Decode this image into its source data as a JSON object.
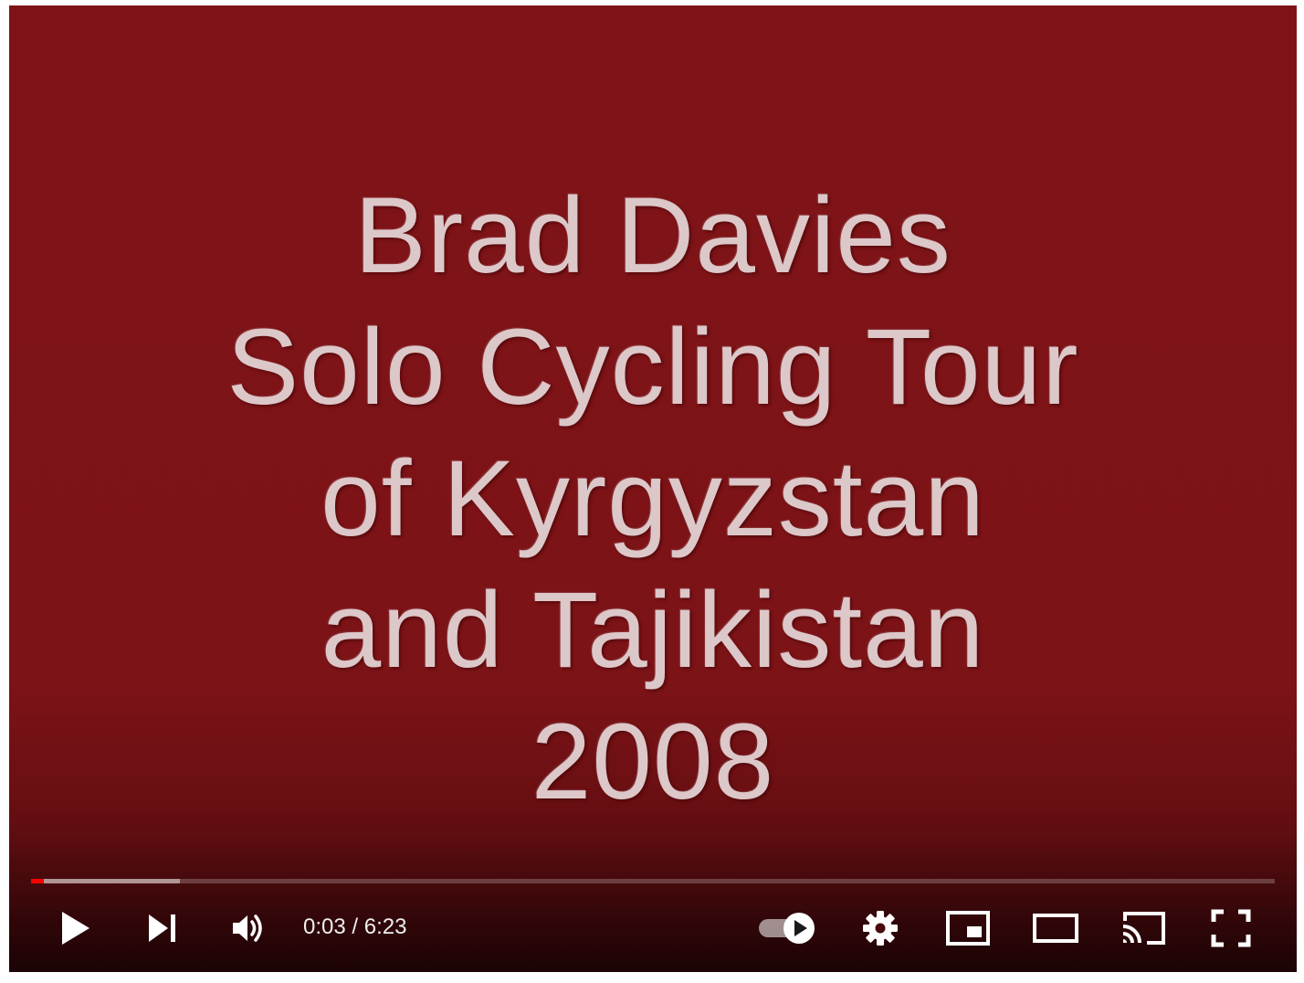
{
  "video": {
    "title_lines": [
      "Brad Davies",
      "Solo Cycling Tour",
      "of Kyrgyzstan",
      "and Tajikistan",
      "2008"
    ]
  },
  "progress": {
    "played_fraction": 0.01,
    "buffered_fraction": 0.12
  },
  "controls": {
    "current_time": "0:03",
    "separator": " / ",
    "duration": "6:23",
    "autoplay_on": true,
    "icons": {
      "play": "play-icon",
      "next": "next-icon",
      "volume": "volume-icon",
      "autoplay": "autoplay-toggle-icon",
      "settings": "gear-icon",
      "miniplayer": "miniplayer-icon",
      "theater": "theater-mode-icon",
      "cast": "cast-icon",
      "fullscreen": "fullscreen-icon"
    }
  },
  "colors": {
    "background": "#7f1418",
    "title_text": "#dcc7c9",
    "progress_played": "#ff0000"
  }
}
